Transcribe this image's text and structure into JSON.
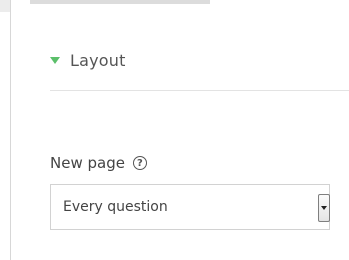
{
  "section": {
    "title": "Layout",
    "expanded": true,
    "accent_color": "#5bbf6a"
  },
  "field": {
    "label": "New page",
    "help_icon": "question-circle-icon",
    "help_glyph": "?",
    "selected_value": "Every question"
  }
}
